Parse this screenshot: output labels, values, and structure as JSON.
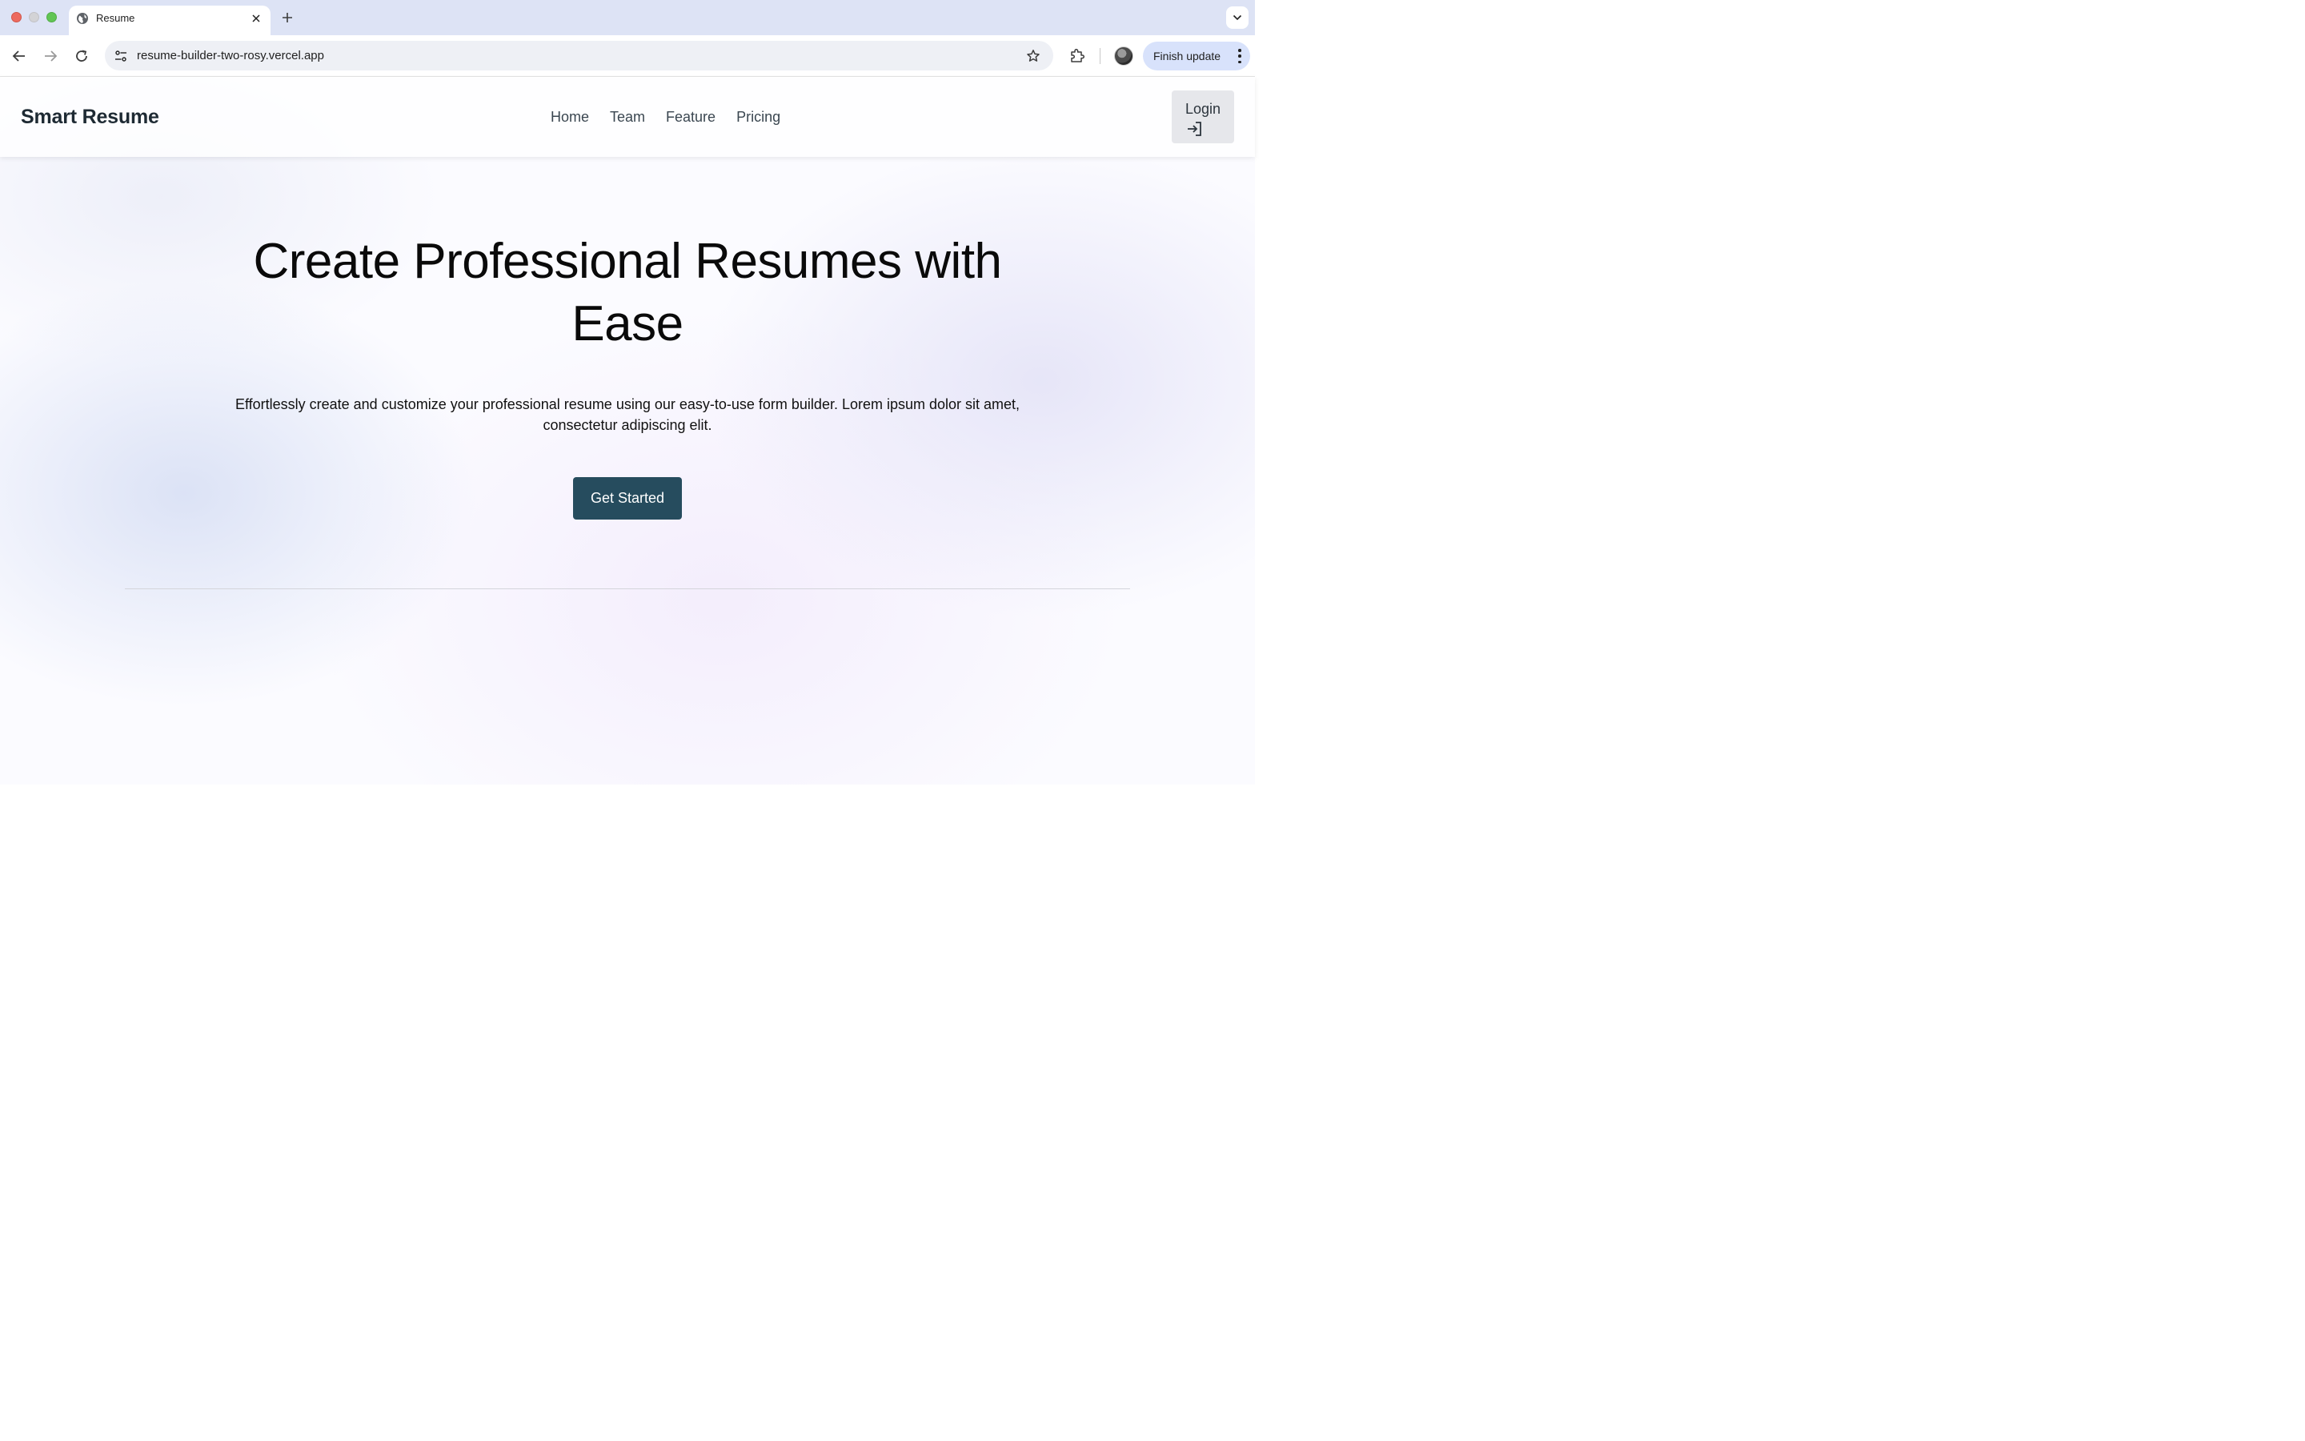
{
  "browser": {
    "tab": {
      "title": "Resume",
      "icon": "globe-icon"
    },
    "omnibox": {
      "url": "resume-builder-two-rosy.vercel.app"
    },
    "finish_update_label": "Finish update"
  },
  "site": {
    "brand": "Smart Resume",
    "nav": [
      {
        "label": "Home"
      },
      {
        "label": "Team"
      },
      {
        "label": "Feature"
      },
      {
        "label": "Pricing"
      }
    ],
    "login_label": "Login"
  },
  "hero": {
    "title": "Create Professional Resumes with Ease",
    "subtitle": "Effortlessly create and customize your professional resume using our easy-to-use form builder. Lorem ipsum dolor sit amet, consectetur adipiscing elit.",
    "cta_label": "Get Started"
  },
  "colors": {
    "cta": "#264c5e",
    "tabbar": "#dde3f5",
    "finish_update": "#d8e2fb"
  }
}
